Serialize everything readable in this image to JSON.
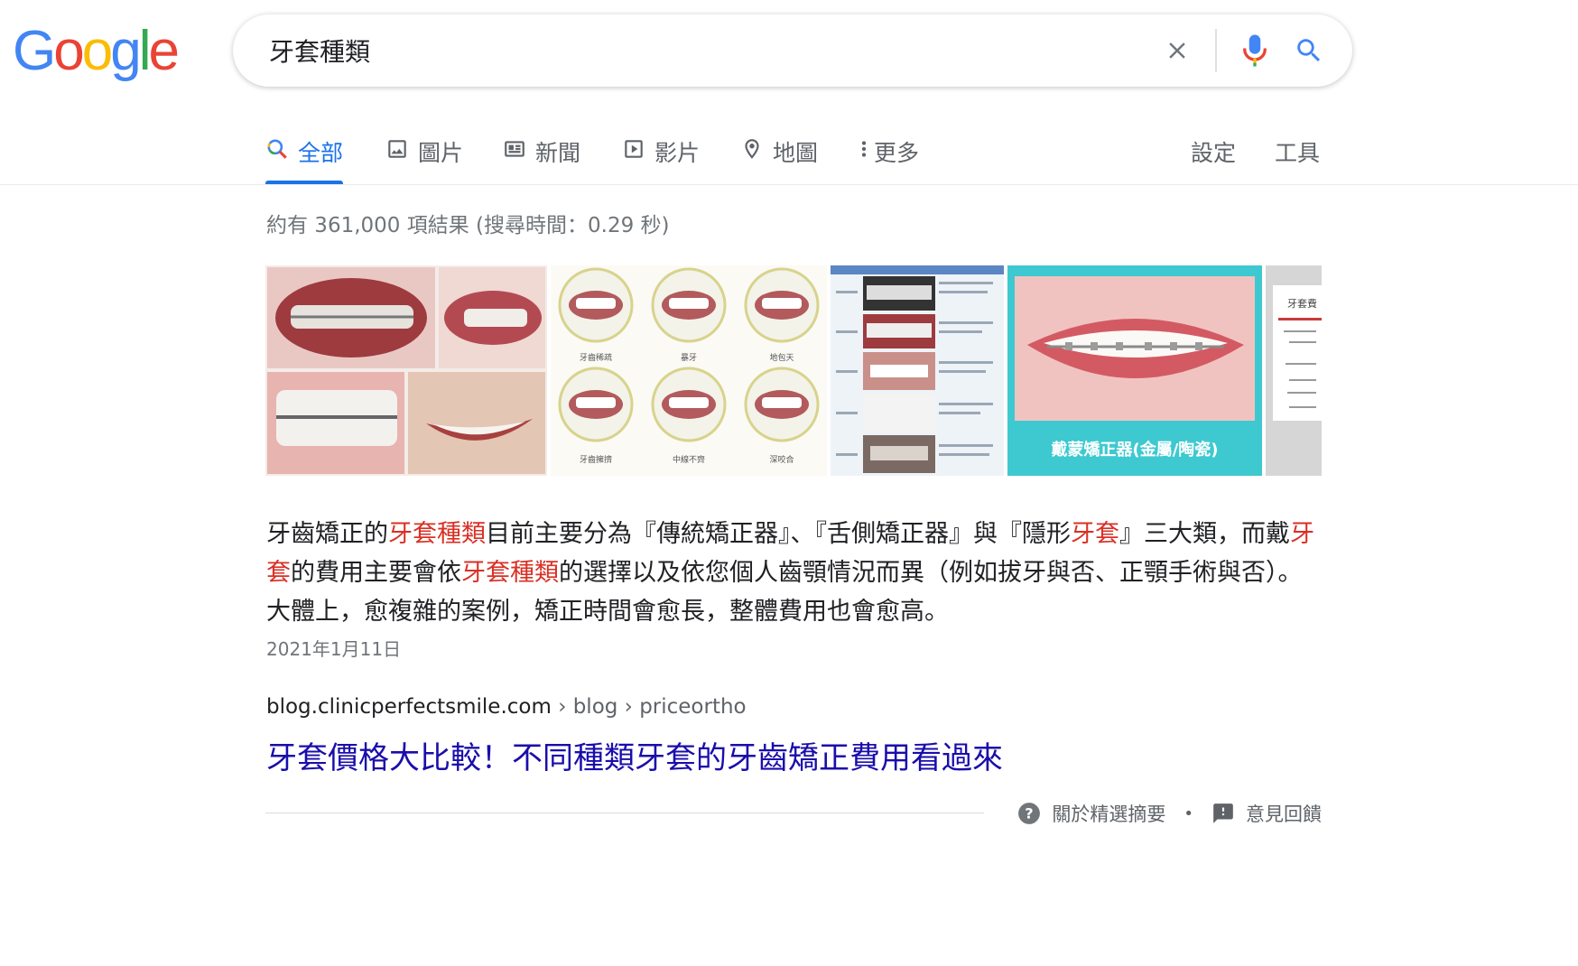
{
  "logo": {
    "text": "Google",
    "letters": [
      "G",
      "o",
      "o",
      "g",
      "l",
      "e"
    ],
    "colors": [
      "#4285F4",
      "#EA4335",
      "#FBBC05",
      "#4285F4",
      "#34A853",
      "#EA4335"
    ]
  },
  "search": {
    "query": "牙套種類"
  },
  "tabs": [
    {
      "label": "全部",
      "icon": "search-multicolor-icon",
      "active": true
    },
    {
      "label": "圖片",
      "icon": "image-icon",
      "active": false
    },
    {
      "label": "新聞",
      "icon": "news-icon",
      "active": false
    },
    {
      "label": "影片",
      "icon": "video-icon",
      "active": false
    },
    {
      "label": "地圖",
      "icon": "map-pin-icon",
      "active": false
    },
    {
      "label": "更多",
      "icon": "more-vert-icon",
      "active": false
    }
  ],
  "tools": {
    "settings": "設定",
    "tools": "工具"
  },
  "stats": "約有 361,000 項結果 (搜尋時間：0.29 秒)",
  "images": {
    "thumb2_labels": [
      "牙齒稀疏",
      "暴牙",
      "地包天",
      "牙齒擁擠",
      "中線不齊",
      "深咬合"
    ],
    "thumb4_caption": "戴蒙矯正器(金屬/陶瓷)",
    "thumb5_label": "牙套費"
  },
  "snippet": {
    "parts": [
      {
        "t": "牙齒矯正的",
        "hl": false
      },
      {
        "t": "牙套種類",
        "hl": true
      },
      {
        "t": "目前主要分為『傳統矯正器』、『舌側矯正器』與『隱形",
        "hl": false
      },
      {
        "t": "牙套",
        "hl": true
      },
      {
        "t": "』三大類，而戴",
        "hl": false
      },
      {
        "t": "牙套",
        "hl": true
      },
      {
        "t": "的費用主要會依",
        "hl": false
      },
      {
        "t": "牙套種類",
        "hl": true
      },
      {
        "t": "的選擇以及依您個人齒顎情況而異（例如拔牙與否、正顎手術與否）。 大體上，愈複雜的案例，矯正時間會愈長，整體費用也會愈高。",
        "hl": false
      }
    ],
    "date": "2021年1月11日"
  },
  "result": {
    "domain": "blog.clinicperfectsmile.com",
    "path": " › blog › priceortho",
    "title": "牙套價格大比較！不同種類牙套的牙齒矯正費用看過來"
  },
  "footer": {
    "about": "關於精選摘要",
    "separator": "•",
    "feedback": "意見回饋"
  },
  "colors": {
    "accent": "#1a73e8",
    "link": "#1a0dab",
    "highlight": "#d93025",
    "teal": "#3ec9d0"
  }
}
